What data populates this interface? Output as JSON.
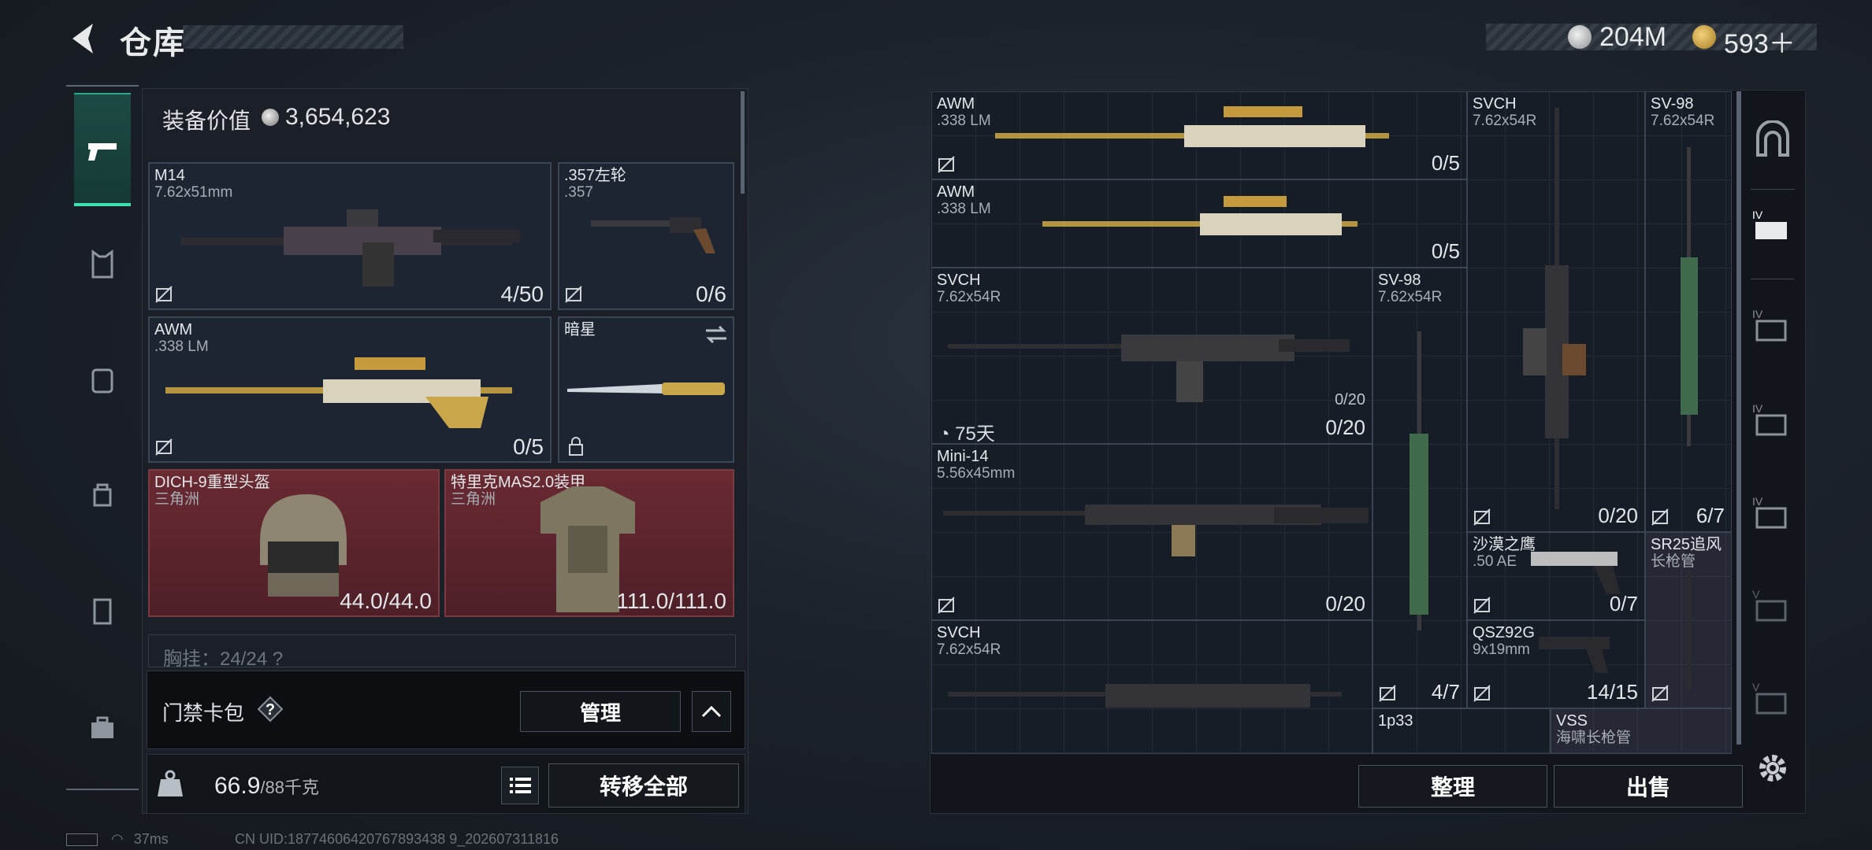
{
  "header": {
    "title": "仓库",
    "currency1": "204M",
    "currency2": "593＋"
  },
  "equipment": {
    "value_label": "装备价值",
    "value": "3,654,623",
    "slots": [
      {
        "name": "M14",
        "cal": "7.62x51mm",
        "ammo": "4/50"
      },
      {
        "name": ".357左轮",
        "cal": ".357",
        "ammo": "0/6"
      },
      {
        "name": "AWM",
        "cal": ".338 LM",
        "ammo": "0/5"
      },
      {
        "name": "暗星",
        "cal": "",
        "ammo": ""
      },
      {
        "name": "DICH-9重型头盔",
        "cal": "三角洲",
        "ammo": "44.0/44.0"
      },
      {
        "name": "特里克MAS2.0装甲",
        "cal": "三角洲",
        "ammo": "111.0/111.0"
      }
    ],
    "partial_row": "胸挂：24/24 ?"
  },
  "gate_bag": {
    "label": "门禁卡包",
    "help": "?",
    "manage": "管理"
  },
  "weight": {
    "value": "66.9",
    "max": "/88千克",
    "transfer": "转移全部"
  },
  "status": {
    "ping": "37ms",
    "uid": "CN UID:18774606420767893438 9_202607311816"
  },
  "warehouse": {
    "items": [
      {
        "name": "AWM",
        "cal": ".338 LM",
        "ammo": "0/5"
      },
      {
        "name": "AWM",
        "cal": ".338 LM",
        "ammo": "0/5"
      },
      {
        "name": "SVCH",
        "cal": "7.62x54R",
        "ammo": "0/20",
        "ammo2": "0/20",
        "timer": "75天"
      },
      {
        "name": "Mini-14",
        "cal": "5.56x45mm",
        "ammo": "0/20"
      },
      {
        "name": "SVCH",
        "cal": "7.62x54R",
        "ammo": ""
      },
      {
        "name": "SVCH",
        "cal": "7.62x54R",
        "ammo": "0/20"
      },
      {
        "name": "SV-98",
        "cal": "7.62x54R",
        "ammo": "6/7"
      },
      {
        "name": "SV-98",
        "cal": "7.62x54R",
        "ammo": "4/7"
      },
      {
        "name": "沙漠之鹰",
        "cal": ".50 AE",
        "ammo": "0/7"
      },
      {
        "name": "SR25追风",
        "cal": "长枪管",
        "ammo": ""
      },
      {
        "name": "QSZ92G",
        "cal": "9x19mm",
        "ammo": "14/15"
      },
      {
        "name": "1p33",
        "cal": "",
        "ammo": ""
      },
      {
        "name": "VSS",
        "cal": "海啸长枪管",
        "ammo": ""
      }
    ],
    "sort": "整理",
    "sell": "出售"
  },
  "colors": {
    "accent": "#3de0b0",
    "red_slot": "#6a2a32",
    "panel": "#1b2028"
  }
}
